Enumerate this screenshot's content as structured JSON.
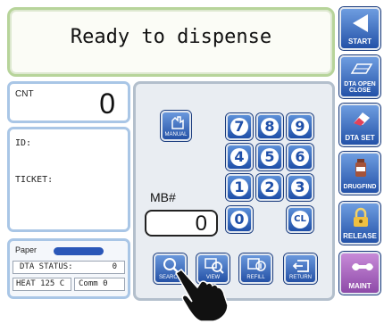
{
  "display": {
    "message": "Ready to dispense"
  },
  "counter": {
    "label": "CNT",
    "value": "0"
  },
  "info": {
    "id_label": "ID:",
    "ticket_label": "TICKET:"
  },
  "status": {
    "paper_label": "Paper",
    "dta_status_label": "DTA STATUS:",
    "dta_status_value": "0",
    "heat_label": "HEAT 125  C",
    "comm_label": "Comm 0"
  },
  "keypad": {
    "keys": [
      "7",
      "8",
      "9",
      "4",
      "5",
      "6",
      "1",
      "2",
      "3",
      "0"
    ],
    "clear_label": "CL",
    "manual_label": "MANUAL"
  },
  "mb": {
    "label": "MB#",
    "value": "0"
  },
  "function_buttons": {
    "search": "SEARCH",
    "view": "VIEW",
    "refill": "REFILL",
    "return": "RETURN"
  },
  "side_buttons": {
    "start": "START",
    "dta_open_close": "DTA OPEN CLOSE",
    "dta_set": "DTA SET",
    "drugfind": "DRUGFIND",
    "release": "RELEASE",
    "maint": "MAINT"
  },
  "icons": {
    "start": "play-left-icon",
    "dta_open_close": "drawer-icon",
    "dta_set": "eraser-icon",
    "drugfind": "bottle-icon",
    "release": "lock-icon",
    "maint": "wrench-icon",
    "search": "magnifier-icon",
    "hand": "pointing-hand-icon"
  }
}
